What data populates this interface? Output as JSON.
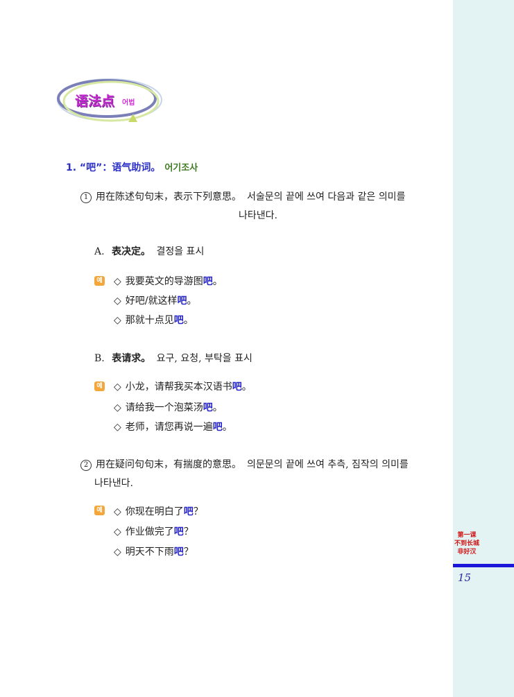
{
  "logo": {
    "zh": "语法点",
    "ko": "어법"
  },
  "section1": {
    "heading": "1. “吧”：语气助词。",
    "heading_ko": "어기조사",
    "usage1": {
      "num": "1",
      "zh": "用在陈述句句末，表示下列意思。",
      "ko_line1": "서술문의 끝에 쓰여 다음과 같은 의미를",
      "ko_line2": "나타낸다."
    },
    "A": {
      "letter": "A.",
      "zh": "表决定。",
      "ko": "결정을 표시",
      "examples": [
        {
          "pre": "我要英文的导游图",
          "ba": "吧",
          "post": "。"
        },
        {
          "pre": "好吧/就这样",
          "ba": "吧",
          "post": "。"
        },
        {
          "pre": "那就十点见",
          "ba": "吧",
          "post": "。"
        }
      ]
    },
    "B": {
      "letter": "B.",
      "zh": "表请求。",
      "ko": "요구, 요청, 부탁을 표시",
      "examples": [
        {
          "pre": "小龙，请帮我买本汉语书",
          "ba": "吧",
          "post": "。"
        },
        {
          "pre": "请给我一个泡菜汤",
          "ba": "吧",
          "post": "。"
        },
        {
          "pre": "老师，请您再说一遍",
          "ba": "吧",
          "post": "。"
        }
      ]
    },
    "usage2": {
      "num": "2",
      "zh": "用在疑问句句末，有揣度的意思。",
      "ko_line1": "의문문의 끝에 쓰여 추측, 짐작의 의미를",
      "ko_line2": "나타낸다.",
      "examples": [
        {
          "pre": "你现在明白了",
          "ba": "吧",
          "post": "？"
        },
        {
          "pre": "作业做完了",
          "ba": "吧",
          "post": "？"
        },
        {
          "pre": "明天不下雨",
          "ba": "吧",
          "post": "？"
        }
      ]
    }
  },
  "example_marker": "예",
  "diamond": "◇",
  "sidebar": {
    "lesson": "第一课",
    "title_line1": "不到长城",
    "title_line2": "非好汉"
  },
  "page_number": "15"
}
